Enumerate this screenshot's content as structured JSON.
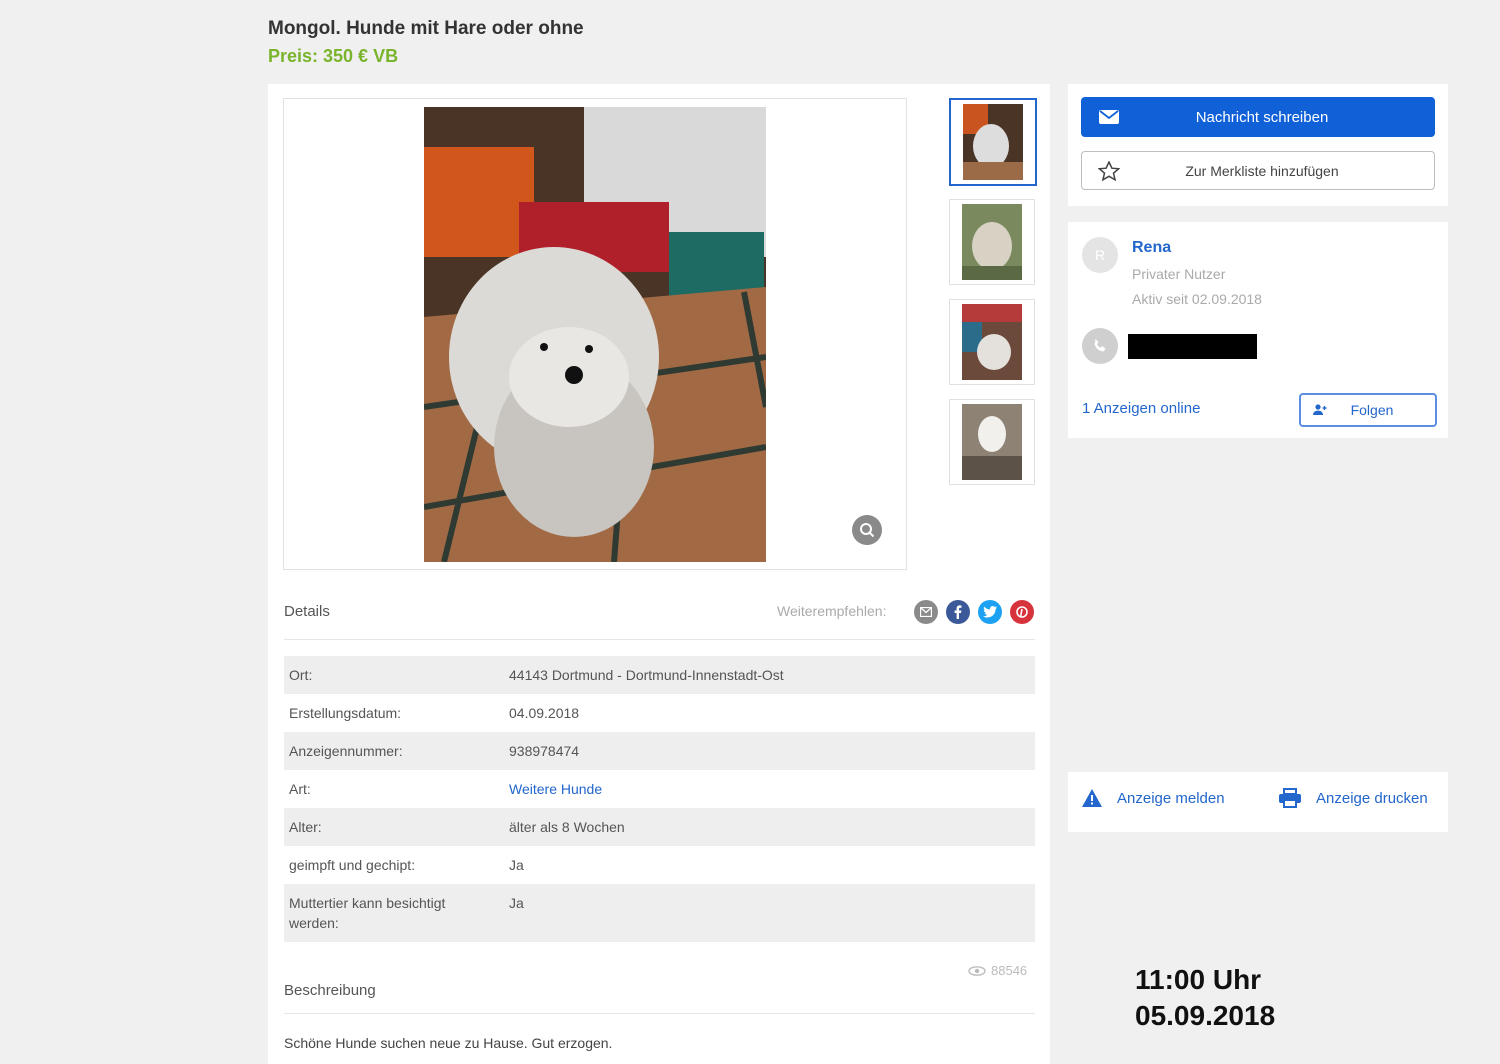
{
  "listing": {
    "title": "Mongol. Hunde mit Hare oder ohne",
    "price": "Preis: 350 € VB"
  },
  "actions": {
    "message_label": "Nachricht schreiben",
    "watchlist_label": "Zur Merkliste hinzufügen"
  },
  "seller": {
    "avatar_initial": "R",
    "name": "Rena",
    "type": "Privater Nutzer",
    "active_since": "Aktiv seit 02.09.2018",
    "ads_online": "1 Anzeigen online",
    "follow_label": "Folgen"
  },
  "details": {
    "label": "Details",
    "share_label": "Weiterempfehlen:",
    "rows": [
      {
        "key": "Ort:",
        "value": "44143 Dortmund - Dortmund-Innenstadt-Ost"
      },
      {
        "key": "Erstellungsdatum:",
        "value": "04.09.2018"
      },
      {
        "key": "Anzeigennummer:",
        "value": "938978474"
      },
      {
        "key": "Art:",
        "value": "Weitere Hunde"
      },
      {
        "key": "Alter:",
        "value": "älter als 8 Wochen"
      },
      {
        "key": "geimpft und gechipt:",
        "value": "Ja"
      },
      {
        "key": "Muttertier kann besichtigt werden:",
        "value": "Ja"
      }
    ]
  },
  "views": "88546",
  "description": {
    "label": "Beschreibung",
    "text": "Schöne Hunde suchen neue zu Hause. Gut erzogen."
  },
  "footer_actions": {
    "report_label": "Anzeige melden",
    "print_label": "Anzeige drucken"
  },
  "stamp": {
    "time": "11:00 Uhr",
    "date": "05.09.2018"
  },
  "colors": {
    "accent": "#1060d8",
    "link": "#2366cc",
    "price": "#7ab42c"
  }
}
